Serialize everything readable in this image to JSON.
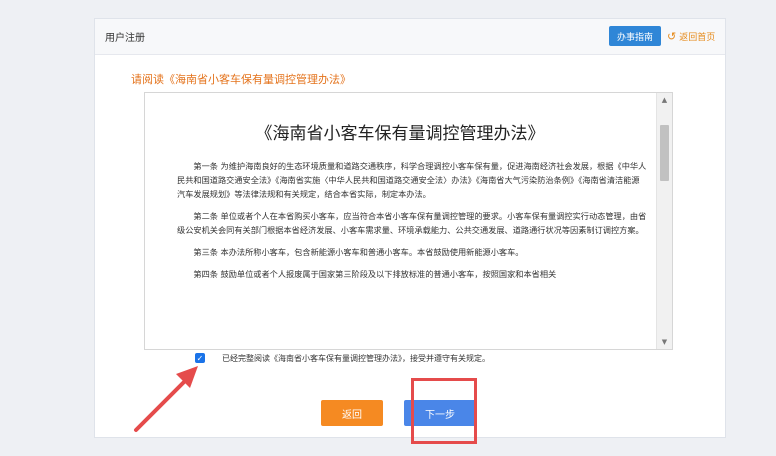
{
  "header": {
    "title": "用户注册",
    "guide_button": "办事指南",
    "back_home": "返回首页"
  },
  "prompt": "请阅读《海南省小客车保有量调控管理办法》",
  "document": {
    "title": "《海南省小客车保有量调控管理办法》",
    "paragraphs": [
      "第一条 为维护海南良好的生态环境质量和道路交通秩序，科学合理调控小客车保有量，促进海南经济社会发展，根据《中华人民共和国道路交通安全法》《海南省实施〈中华人民共和国道路交通安全法〉办法》《海南省大气污染防治条例》《海南省清洁能源汽车发展规划》等法律法规和有关规定，结合本省实际，制定本办法。",
      "第二条 单位或者个人在本省购买小客车，应当符合本省小客车保有量调控管理的要求。小客车保有量调控实行动态管理，由省级公安机关会同有关部门根据本省经济发展、小客车需求量、环境承载能力、公共交通发展、道路通行状况等因素制订调控方案。",
      "第三条 本办法所称小客车，包含新能源小客车和普通小客车。本省鼓励使用新能源小客车。",
      "第四条 鼓励单位或者个人报废属于国家第三阶段及以下排放标准的普通小客车，按照国家和本省相关"
    ]
  },
  "agreement": {
    "checked": true,
    "text": "已经完整阅读《海南省小客车保有量调控管理办法》，接受并遵守有关规定。"
  },
  "buttons": {
    "back": "返回",
    "next": "下一步"
  },
  "colors": {
    "primary": "#2f86d7",
    "orange": "#f58a22",
    "annotation_red": "#e54b4b"
  }
}
